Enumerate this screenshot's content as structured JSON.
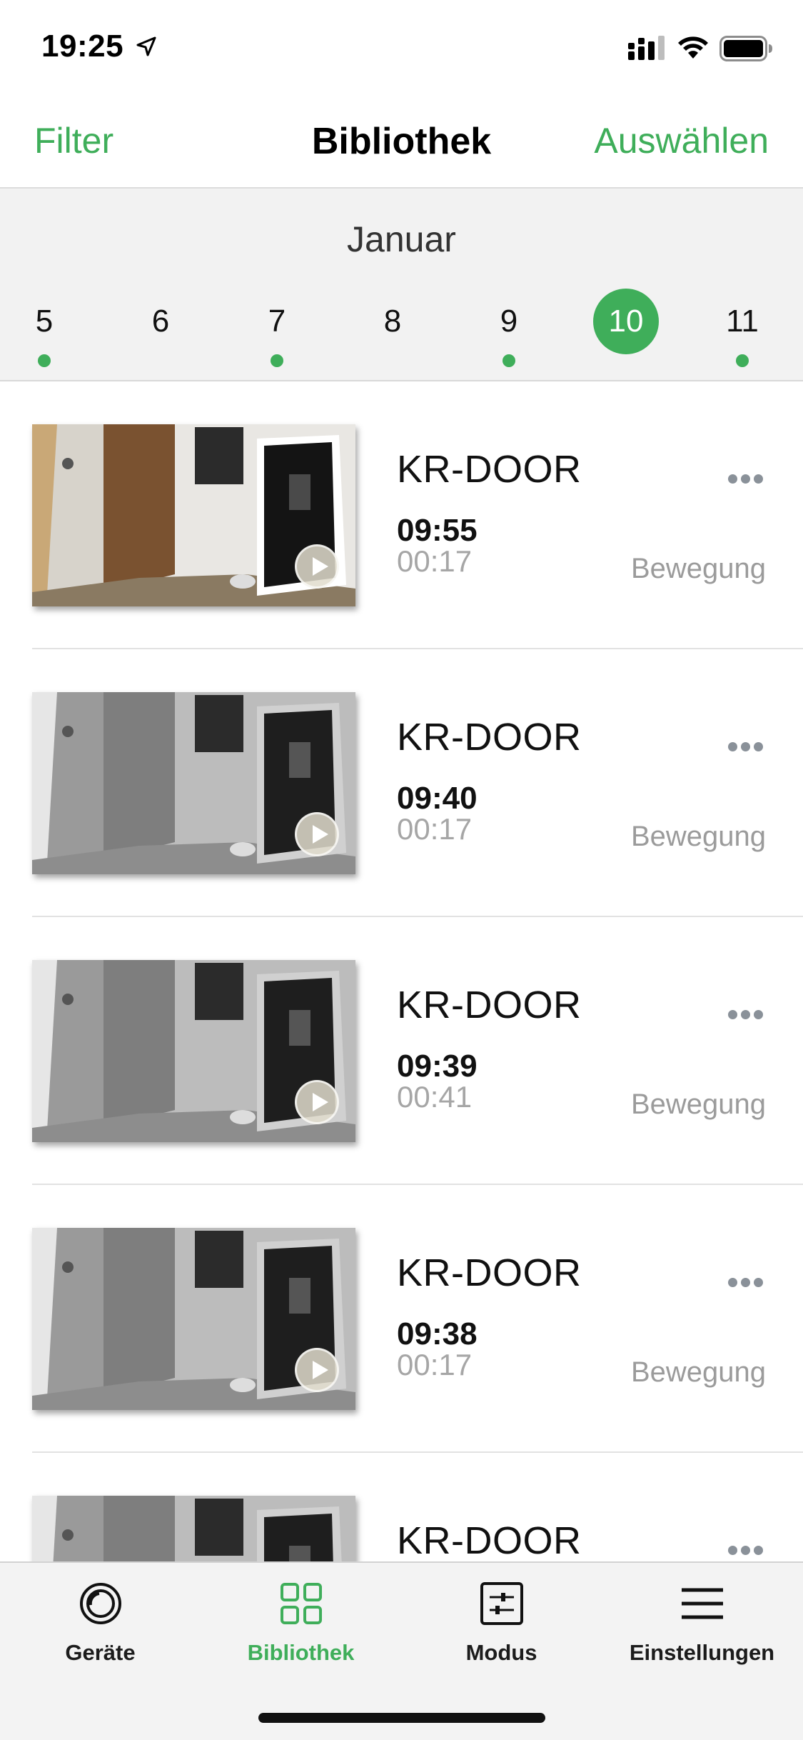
{
  "status_bar": {
    "time": "19:25"
  },
  "nav": {
    "left": "Filter",
    "title": "Bibliothek",
    "right": "Auswählen"
  },
  "calendar": {
    "month": "Januar",
    "days": [
      {
        "num": "5",
        "has_recordings": true,
        "selected": false
      },
      {
        "num": "6",
        "has_recordings": false,
        "selected": false
      },
      {
        "num": "7",
        "has_recordings": true,
        "selected": false
      },
      {
        "num": "8",
        "has_recordings": false,
        "selected": false
      },
      {
        "num": "9",
        "has_recordings": true,
        "selected": false
      },
      {
        "num": "10",
        "has_recordings": false,
        "selected": true
      },
      {
        "num": "11",
        "has_recordings": true,
        "selected": false
      }
    ]
  },
  "recordings": [
    {
      "camera": "KR-DOOR",
      "time": "09:55",
      "duration": "00:17",
      "type": "Bewegung",
      "thumb": "color"
    },
    {
      "camera": "KR-DOOR",
      "time": "09:40",
      "duration": "00:17",
      "type": "Bewegung",
      "thumb": "night"
    },
    {
      "camera": "KR-DOOR",
      "time": "09:39",
      "duration": "00:41",
      "type": "Bewegung",
      "thumb": "night"
    },
    {
      "camera": "KR-DOOR",
      "time": "09:38",
      "duration": "00:17",
      "type": "Bewegung",
      "thumb": "night"
    },
    {
      "camera": "KR-DOOR",
      "time": "",
      "duration": "",
      "type": "",
      "thumb": "night"
    }
  ],
  "tabs": [
    {
      "label": "Geräte",
      "icon": "camera-lens-icon",
      "active": false
    },
    {
      "label": "Bibliothek",
      "icon": "grid-icon",
      "active": true
    },
    {
      "label": "Modus",
      "icon": "sliders-icon",
      "active": false
    },
    {
      "label": "Einstellungen",
      "icon": "menu-icon",
      "active": false
    }
  ],
  "colors": {
    "accent": "#3fae5a",
    "secondary_text": "#a6a6a6",
    "calendar_bg": "#f2f2f2"
  }
}
